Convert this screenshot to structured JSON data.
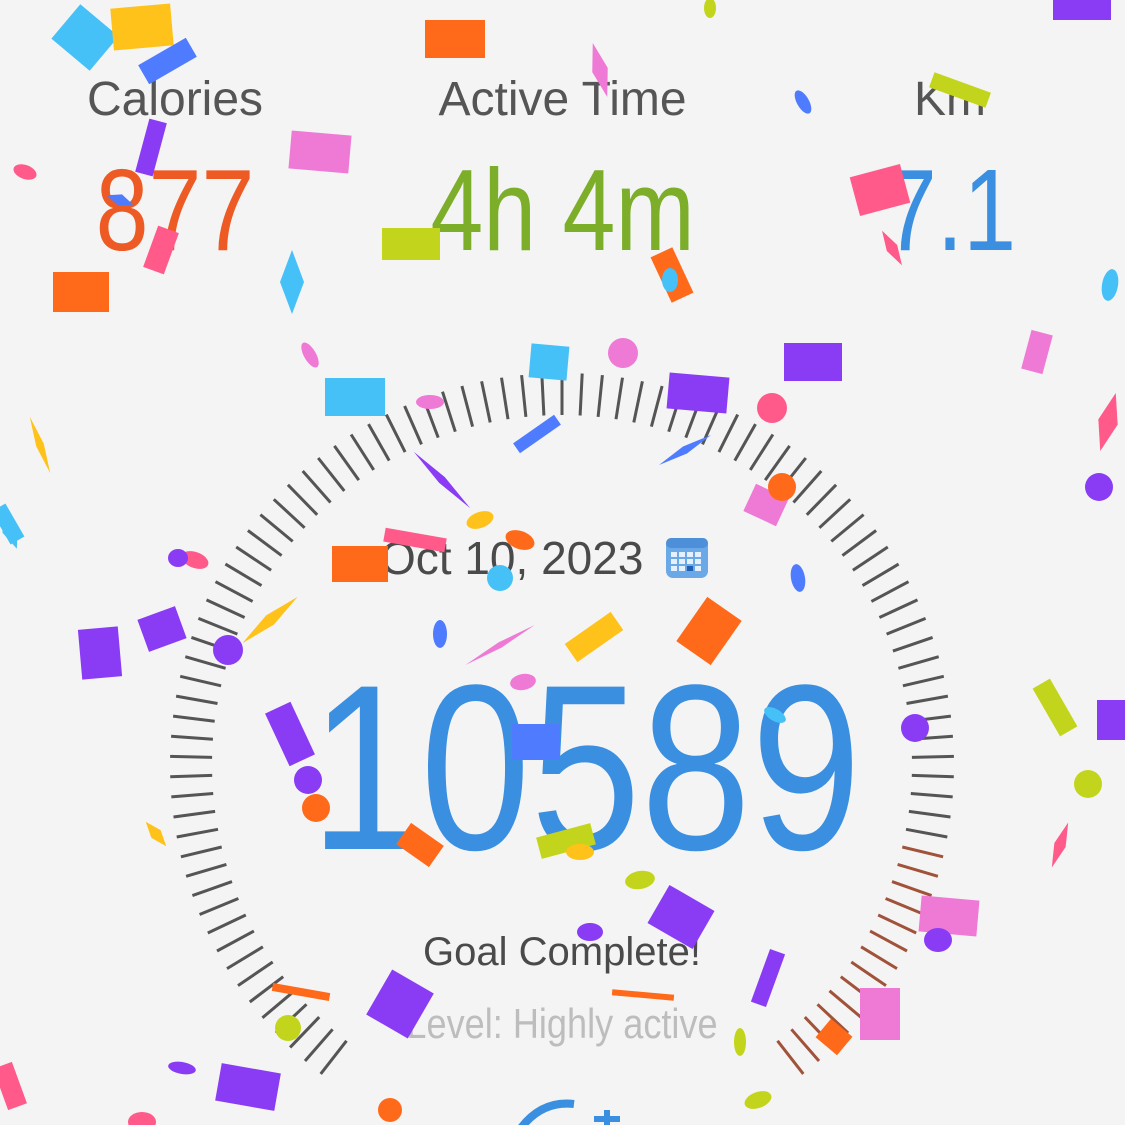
{
  "stats": {
    "calories": {
      "label": "Calories",
      "value": "877",
      "color": "#ee5a24"
    },
    "active_time": {
      "label": "Active Time",
      "value": "4h 4m",
      "color": "#7cae2a"
    },
    "km": {
      "label": "Km",
      "value": "7.1",
      "color": "#3a8fe0"
    }
  },
  "gauge": {
    "date": "Oct 10, 2023",
    "date_icon": "calendar-icon",
    "steps": "10589",
    "steps_color": "#3a8fe0",
    "goal_status": "Goal Complete!",
    "level": "Level: Highly active",
    "goal_progress": 1.0,
    "tick_color": "#555555",
    "tick_accent_color": "#a0523a"
  },
  "overlay": {
    "effect": "confetti",
    "colors": [
      "#ff6a1a",
      "#8a3cf5",
      "#45c1f7",
      "#ee7ad6",
      "#c2d51c",
      "#ffc21a",
      "#4f7cff",
      "#ff5a8a"
    ]
  }
}
